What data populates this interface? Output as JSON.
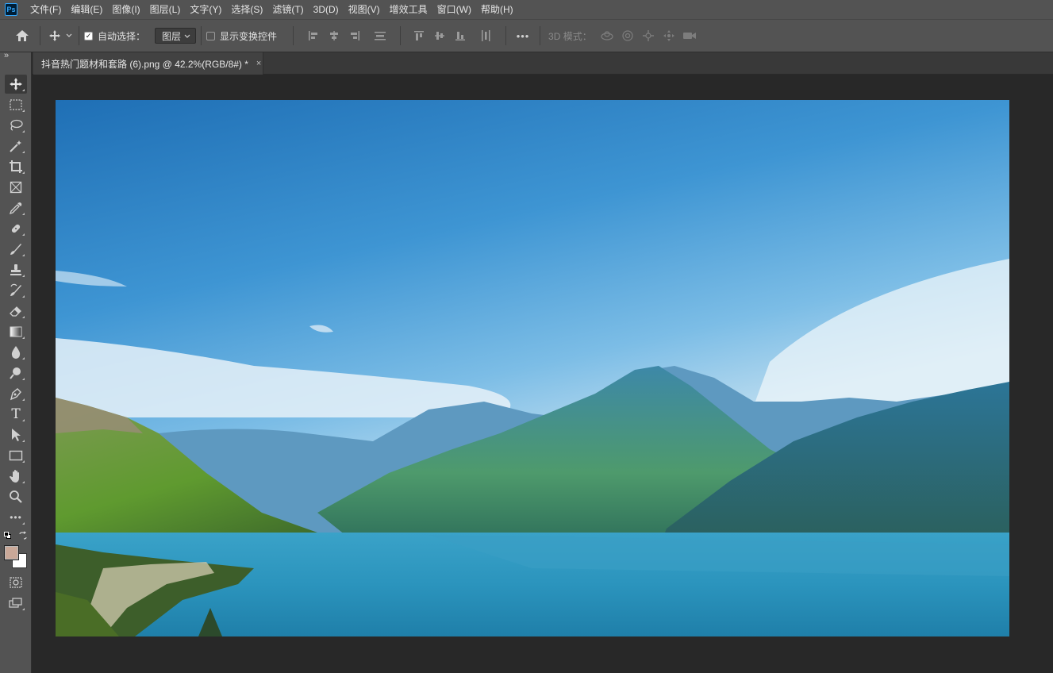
{
  "app": {
    "logo": "Ps",
    "name": "Photoshop"
  },
  "menu": [
    "文件(F)",
    "编辑(E)",
    "图像(I)",
    "图层(L)",
    "文字(Y)",
    "选择(S)",
    "滤镜(T)",
    "3D(D)",
    "视图(V)",
    "增效工具",
    "窗口(W)",
    "帮助(H)"
  ],
  "options": {
    "auto_select_label": "自动选择：",
    "auto_select_checked": true,
    "auto_select_target": "图层",
    "show_transform_label": "显示变换控件",
    "show_transform_checked": false,
    "more": "•••",
    "mode_3d_label": "3D 模式："
  },
  "document": {
    "tab_title": "抖音热门题材和套路 (6).png @ 42.2%(RGB/8#) *",
    "close": "×"
  },
  "toolbar": {
    "expand": "»",
    "tools": [
      "move-tool",
      "marquee-tool",
      "lasso-tool",
      "magic-wand-tool",
      "crop-tool",
      "frame-tool",
      "eyedropper-tool",
      "healing-brush-tool",
      "brush-tool",
      "clone-stamp-tool",
      "history-brush-tool",
      "eraser-tool",
      "gradient-tool",
      "blur-tool",
      "dodge-tool",
      "pen-tool",
      "type-tool",
      "path-selection-tool",
      "rectangle-tool",
      "hand-tool",
      "zoom-tool",
      "edit-toolbar"
    ],
    "type_glyph": "T",
    "more_glyph": "•••",
    "foreground_color": "#c9a898",
    "background_color": "#ffffff"
  },
  "colors": {
    "menubar": "#535353",
    "canvas_bg": "#282828",
    "accent": "#31a8ff"
  }
}
